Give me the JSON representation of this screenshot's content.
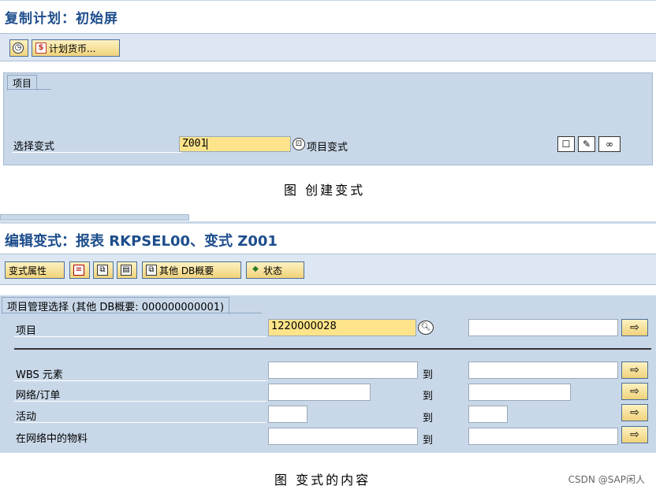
{
  "screen1": {
    "title": "复制计划：初始屏",
    "toolbar": {
      "clock_icon": "clock-icon",
      "plan_currency_label": "计划货币..."
    },
    "tab_label": "项目",
    "select_variant_label": "选择变式",
    "variant_value": "Z001",
    "project_variant_label": "项目变式",
    "action_icons": [
      "create-icon",
      "pencil-icon",
      "glasses-icon"
    ]
  },
  "caption1": "图 创建变式",
  "screen2": {
    "title": "编辑变式：报表 RKPSEL00、变式 Z001",
    "toolbar": {
      "variant_attr_label": "变式属性",
      "other_db_label": "其他 DB概要",
      "status_label": "状态"
    },
    "tab_label": "项目管理选择 (其他 DB概要: 000000000001)",
    "rows": [
      {
        "label": "项目",
        "from": "1220000028",
        "to_label": "",
        "to": ""
      },
      {
        "label": "WBS 元素",
        "from": "",
        "to_label": "到",
        "to": ""
      },
      {
        "label": "网络/订单",
        "from": "",
        "to_label": "到",
        "to": ""
      },
      {
        "label": "活动",
        "from": "",
        "to_label": "到",
        "to": ""
      },
      {
        "label": "在网络中的物料",
        "from": "",
        "to_label": "到",
        "to": ""
      }
    ]
  },
  "caption2": "图 变式的内容",
  "watermark": "CSDN @SAP闲人",
  "colors": {
    "title": "#1d4d8c",
    "panel": "#c9d8e9",
    "toolbar": "#dce7f3",
    "input_required": "#fde48a"
  }
}
